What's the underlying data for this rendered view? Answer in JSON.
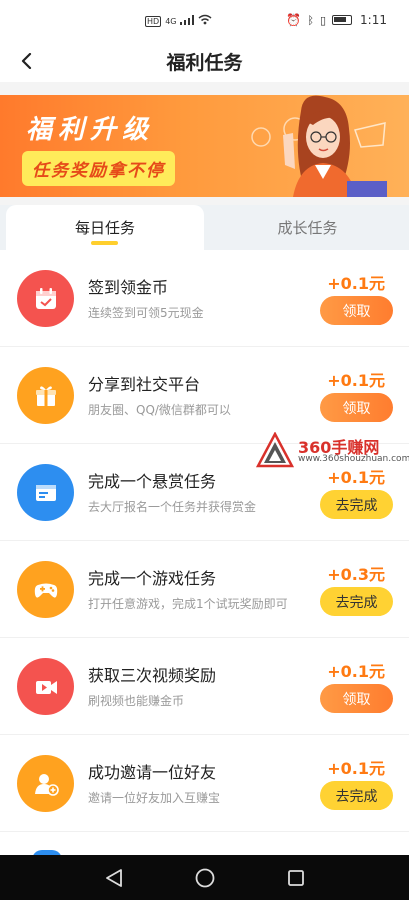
{
  "status_bar": {
    "time": "1:11",
    "network": "HD",
    "signal_label": "4G"
  },
  "nav": {
    "title": "福利任务"
  },
  "banner": {
    "title": "福利升级",
    "subtitle": "任务奖励拿不停"
  },
  "tabs": [
    {
      "label": "每日任务",
      "active": true
    },
    {
      "label": "成长任务",
      "active": false
    }
  ],
  "tasks": [
    {
      "title": "签到领金币",
      "desc": "连续签到可领5元现金",
      "reward": "+0.1元",
      "button": "领取",
      "icon": "calendar-icon",
      "color": "#f4534f"
    },
    {
      "title": "分享到社交平台",
      "desc": "朋友圈、QQ/微信群都可以",
      "reward": "+0.1元",
      "button": "领取",
      "icon": "gift-icon",
      "color": "#ffa21f"
    },
    {
      "title": "完成一个悬赏任务",
      "desc": "去大厅报名一个任务并获得赏金",
      "reward": "+0.1元",
      "button": "去完成",
      "icon": "card-icon",
      "color": "#2d8ef0"
    },
    {
      "title": "完成一个游戏任务",
      "desc": "打开任意游戏，完成1个试玩奖励即可",
      "reward": "+0.3元",
      "button": "去完成",
      "icon": "gamepad-icon",
      "color": "#ffa21f"
    },
    {
      "title": "获取三次视频奖励",
      "desc": "刷视频也能赚金币",
      "reward": "+0.1元",
      "button": "领取",
      "icon": "video-icon",
      "color": "#f4534f"
    },
    {
      "title": "成功邀请一位好友",
      "desc": "邀请一位好友加入互赚宝",
      "reward": "+0.1元",
      "button": "去完成",
      "icon": "add-user-icon",
      "color": "#ffa21f"
    }
  ],
  "watermark": {
    "title": "360手赚网",
    "url": "www.360shouzhuan.com"
  },
  "colors": {
    "accent": "#ff7a12",
    "claim_button": "#ff8a38",
    "go_button": "#ffd233",
    "tab_indicator": "#ffcf2d"
  }
}
